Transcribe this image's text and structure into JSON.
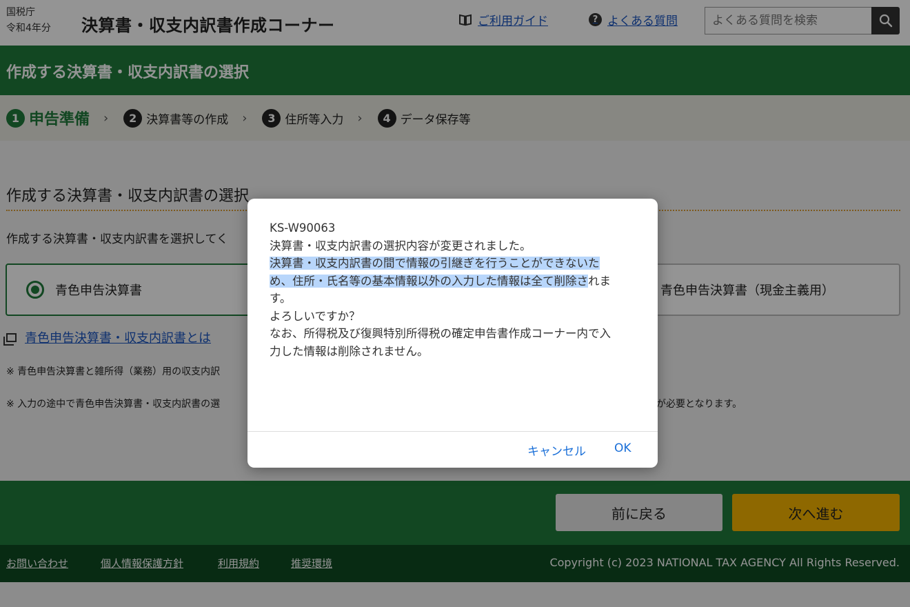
{
  "header": {
    "agency_line1": "国税庁",
    "agency_line2": "令和4年分",
    "app_title": "決算書・収支内訳書作成コーナー",
    "guide_link": "ご利用ガイド",
    "faq_link": "よくある質問",
    "search_placeholder": "よくある質問を検索",
    "icons": {
      "guide": "book-icon",
      "faq": "question-circle-icon",
      "search": "magnifier-icon"
    }
  },
  "band": {
    "title": "作成する決算書・収支内訳書の選択"
  },
  "steps": [
    {
      "num": "1",
      "label": "申告準備",
      "active": true
    },
    {
      "num": "2",
      "label": "決算書等の作成",
      "active": false
    },
    {
      "num": "3",
      "label": "住所等入力",
      "active": false
    },
    {
      "num": "4",
      "label": "データ保存等",
      "active": false
    }
  ],
  "main": {
    "section_title": "作成する決算書・収支内訳書の選択",
    "instruction": "作成する決算書・収支内訳書を選択してく",
    "options": {
      "selected": "青色申告決算書",
      "right": "青色申告決算書（現金主義用）"
    },
    "about_link": "青色申告決算書・収支内訳書とは",
    "note1": "※ 青色申告決算書と雑所得（業務）用の収支内訳",
    "note2": "※ 入力の途中で青色申告決算書・収支内訳書の選",
    "note2_tail": "が必要となります。"
  },
  "nav": {
    "back_label": "前に戻る",
    "next_label": "次へ進む"
  },
  "footer": {
    "links": [
      "お問い合わせ",
      "個人情報保護方針",
      "利用規約",
      "推奨環境"
    ],
    "copyright": "Copyright (c) 2023 NATIONAL TAX AGENCY All Rights Reserved."
  },
  "dialog": {
    "code": "KS-W90063",
    "line1": "決算書・収支内訳書の選択内容が変更されました。",
    "hl_line1": "決算書・収支内訳書の間で情報の引継ぎを行うことができないた",
    "hl_line2": "め、住所・氏名等の基本情報以外の入力した情報は全て削除さ",
    "line2_tail": "れま",
    "line3": "す。",
    "line4": "よろしいですか？",
    "line5": "なお、所得税及び復興特別所得税の確定申告書作成コーナー内で入",
    "line6": "力した情報は削除されません。",
    "cancel_label": "キャンセル",
    "ok_label": "OK"
  },
  "colors": {
    "brand_green": "#1f7a3b",
    "footer_green": "#0f4a22",
    "next_button": "#f5b400",
    "link_blue": "#1a55c0",
    "dialog_button": "#1a6fd8",
    "selection_highlight": "#b8d6fb"
  }
}
